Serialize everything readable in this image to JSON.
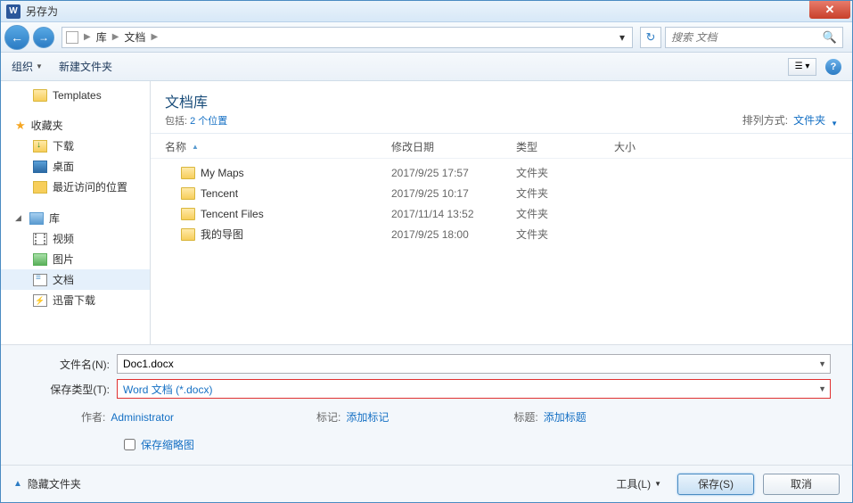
{
  "title": "另存为",
  "breadcrumb": {
    "root": "库",
    "current": "文档"
  },
  "search": {
    "placeholder": "搜索 文档"
  },
  "toolbar": {
    "organize": "组织",
    "newfolder": "新建文件夹"
  },
  "sidebar": {
    "templates": "Templates",
    "favorites": "收藏夹",
    "downloads": "下载",
    "desktop": "桌面",
    "recent": "最近访问的位置",
    "libraries": "库",
    "videos": "视频",
    "pictures": "图片",
    "documents": "文档",
    "thunder": "迅雷下载"
  },
  "lib": {
    "title": "文档库",
    "include_label": "包括:",
    "include_link": "2 个位置",
    "sort_label": "排列方式:",
    "sort_value": "文件夹"
  },
  "cols": {
    "name": "名称",
    "date": "修改日期",
    "type": "类型",
    "size": "大小"
  },
  "files": [
    {
      "name": "My Maps",
      "date": "2017/9/25 17:57",
      "type": "文件夹"
    },
    {
      "name": "Tencent",
      "date": "2017/9/25 10:17",
      "type": "文件夹"
    },
    {
      "name": "Tencent Files",
      "date": "2017/11/14 13:52",
      "type": "文件夹"
    },
    {
      "name": "我的导图",
      "date": "2017/9/25 18:00",
      "type": "文件夹"
    }
  ],
  "form": {
    "filename_label": "文件名(N):",
    "filename_value": "Doc1.docx",
    "filetype_label": "保存类型(T):",
    "filetype_value": "Word 文档 (*.docx)"
  },
  "meta": {
    "author_label": "作者:",
    "author_value": "Administrator",
    "tags_label": "标记:",
    "tags_value": "添加标记",
    "title_label": "标题:",
    "title_value": "添加标题"
  },
  "thumb_label": "保存缩略图",
  "footer": {
    "hide": "隐藏文件夹",
    "tools": "工具(L)",
    "save": "保存(S)",
    "cancel": "取消"
  }
}
